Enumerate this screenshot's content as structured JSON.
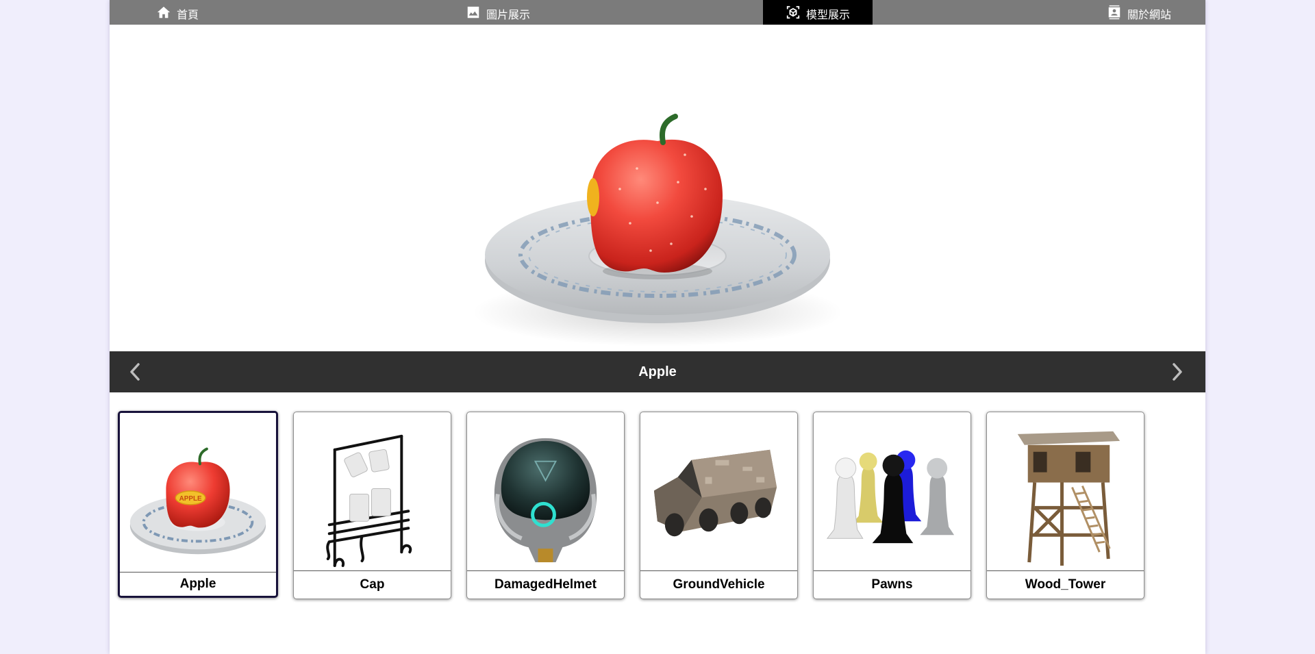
{
  "nav": {
    "items": [
      {
        "label": "首頁",
        "icon": "home-icon"
      },
      {
        "label": "圖片展示",
        "icon": "image-icon"
      },
      {
        "label": "模型展示",
        "icon": "3d-model-icon"
      },
      {
        "label": "關於網站",
        "icon": "contact-card-icon"
      }
    ],
    "active_index": 2
  },
  "viewer": {
    "current_title": "Apple"
  },
  "thumbnails": [
    {
      "name": "Apple",
      "selected": true
    },
    {
      "name": "Cap",
      "selected": false
    },
    {
      "name": "DamagedHelmet",
      "selected": false
    },
    {
      "name": "GroundVehicle",
      "selected": false
    },
    {
      "name": "Pawns",
      "selected": false
    },
    {
      "name": "Wood_Tower",
      "selected": false
    }
  ],
  "apple_label_text": "APPLE",
  "colors": {
    "nav_bg": "#7b7b7b",
    "nav_active_bg": "#000000",
    "caption_bg": "#303030",
    "page_bg": "#f0eefc",
    "selected_border": "#18123a"
  }
}
